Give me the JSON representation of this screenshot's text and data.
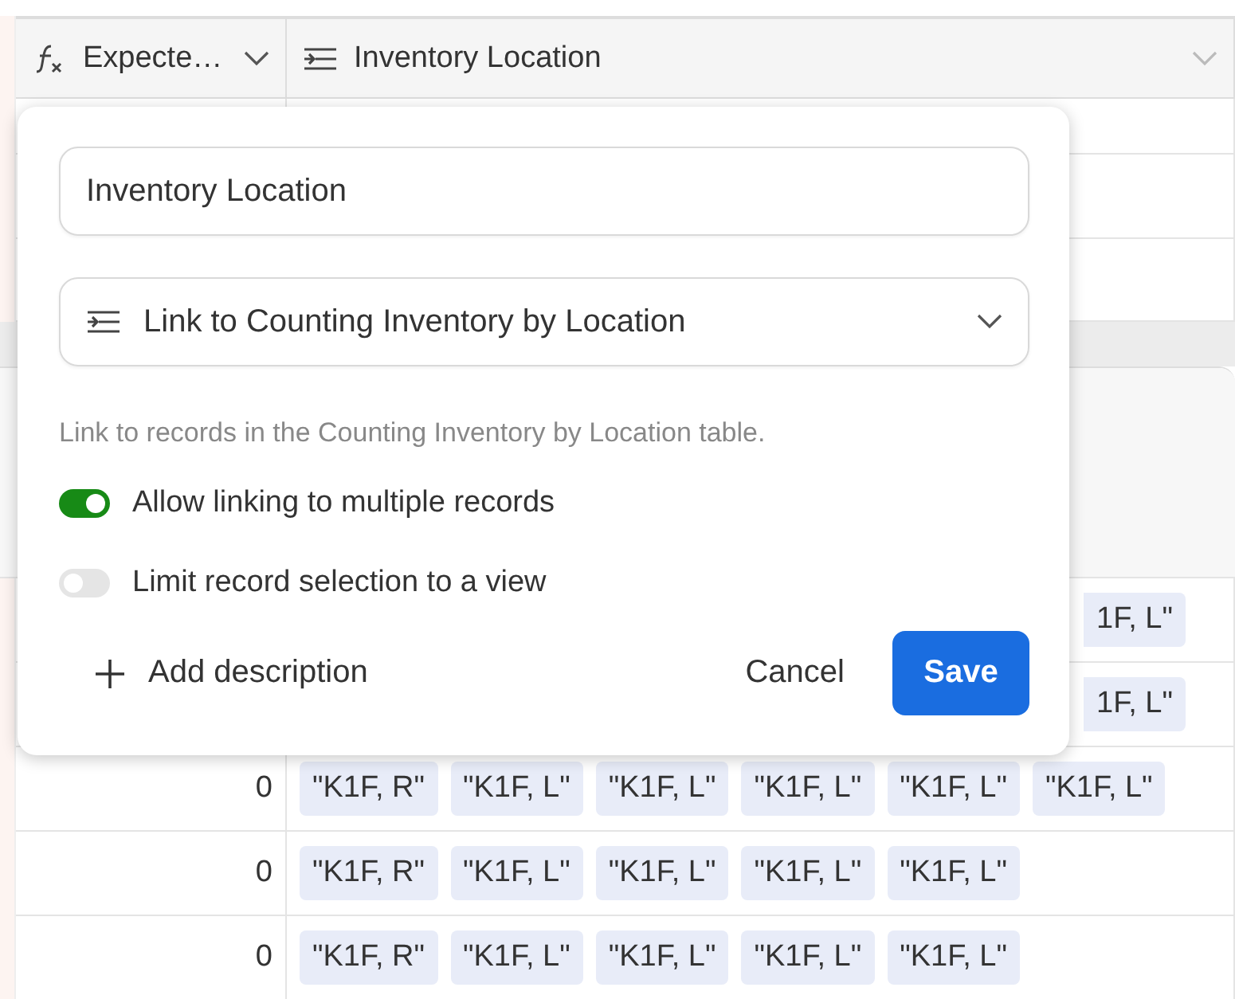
{
  "columns": [
    {
      "kind": "formula",
      "label": "Expecte…"
    },
    {
      "kind": "link",
      "label": "Inventory Location"
    }
  ],
  "rows": [
    {
      "covered": true,
      "links": [
        "1F, L\""
      ]
    },
    {
      "covered": true,
      "links": [
        "1F, L\""
      ]
    },
    {
      "covered": false,
      "expected": "0",
      "links": [
        "\"K1F, R\"",
        "\"K1F, L\"",
        "\"K1F, L\"",
        "\"K1F, L\"",
        "\"K1F, L\"",
        "\"K1F, L\""
      ]
    },
    {
      "covered": false,
      "expected": "0",
      "links": [
        "\"K1F, R\"",
        "\"K1F, L\"",
        "\"K1F, L\"",
        "\"K1F, L\"",
        "\"K1F, L\""
      ]
    },
    {
      "covered": false,
      "expected": "0",
      "links": [
        "\"K1F, R\"",
        "\"K1F, L\"",
        "\"K1F, L\"",
        "\"K1F, L\"",
        "\"K1F, L\""
      ]
    }
  ],
  "popover": {
    "name_field": {
      "value": "Inventory Location"
    },
    "type_select": {
      "kind": "link",
      "label": "Link to Counting Inventory by Location"
    },
    "description": "Link to records in the Counting Inventory by Location table.",
    "toggles": [
      {
        "label": "Allow linking to multiple records",
        "on": true
      },
      {
        "label": "Limit record selection to a view",
        "on": false
      }
    ],
    "add_description": "Add description",
    "cancel": "Cancel",
    "save": "Save"
  }
}
